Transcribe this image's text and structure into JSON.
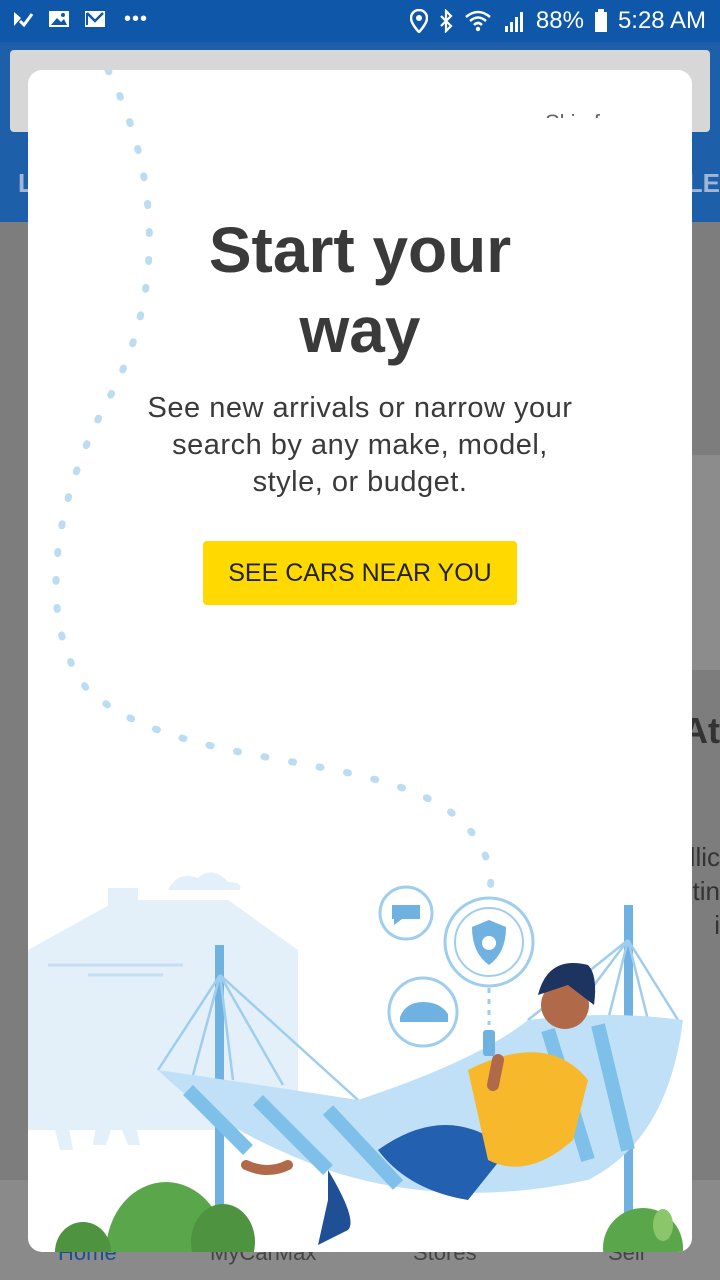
{
  "status_bar": {
    "left_icons": [
      "check-icon",
      "image-icon",
      "mail-icon"
    ],
    "more": "•••",
    "battery": "88%",
    "time": "5:28 AM"
  },
  "background_app": {
    "tab_left_fragment": "L",
    "tab_right_fragment": "TLE",
    "heading_fragment": "At",
    "text_fragments": [
      "illic",
      "tin",
      "i"
    ],
    "nav": {
      "home": "Home",
      "mycarmax": "MyCarMax",
      "stores": "Stores",
      "sell": "Sell"
    }
  },
  "modal": {
    "skip_label": "Skip for now",
    "title_line1": "Start your",
    "title_line2": "way",
    "subtitle": "See new arrivals or narrow your search by any make, model, style, or budget.",
    "cta_label": "SEE CARS NEAR YOU"
  },
  "colors": {
    "status_bar": "#0f57a8",
    "accent_yellow": "#ffd900",
    "illustration_blue": "#7fbde6",
    "plant_green": "#5aa64a"
  }
}
